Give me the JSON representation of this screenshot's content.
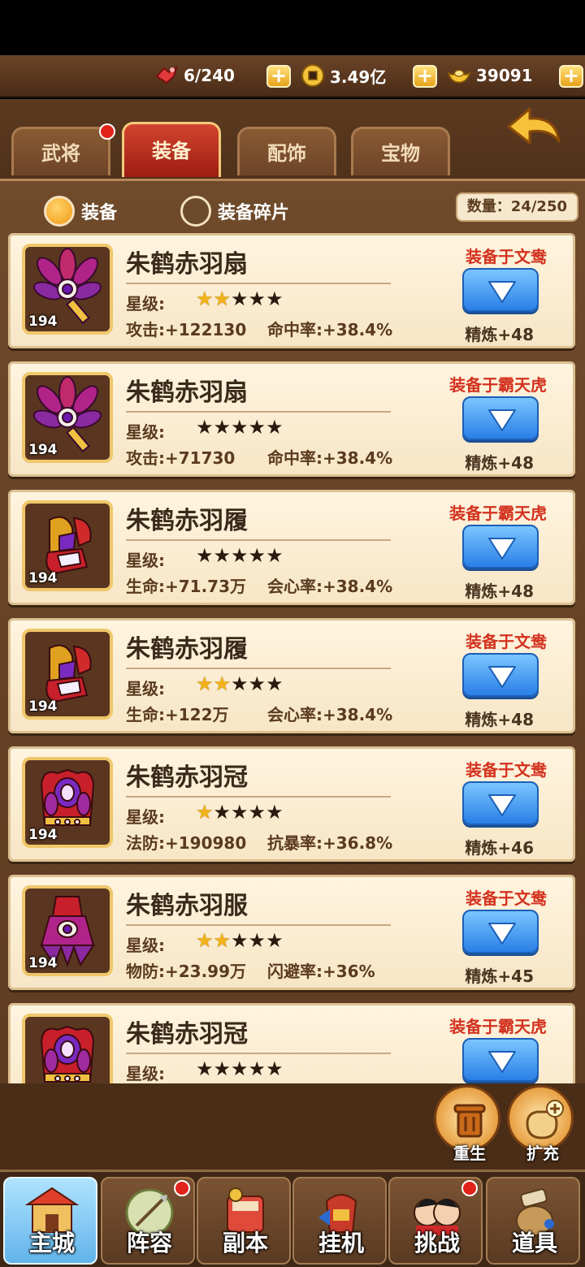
{
  "resources": {
    "stamina": "6/240",
    "coins": "3.49亿",
    "ingots": "39091"
  },
  "tabs": [
    {
      "label": "武将",
      "active": false,
      "has_dot": true
    },
    {
      "label": "装备",
      "active": true,
      "has_dot": false
    },
    {
      "label": "配饰",
      "active": false,
      "has_dot": false
    },
    {
      "label": "宝物",
      "active": false,
      "has_dot": false
    }
  ],
  "filters": {
    "equipment": "装备",
    "fragments": "装备碎片",
    "selected": "装备"
  },
  "count_label": "数量：24/250",
  "star_label": "星级:",
  "items": [
    {
      "name": "朱鹤赤羽扇",
      "level": "194",
      "gold_stars": 2,
      "total_stars": 5,
      "stat1": "攻击:+122130",
      "stat2": "命中率:+38.4%",
      "equipped_by": "装备于文鸯",
      "refine": "精炼+48",
      "icon": "fan-icon"
    },
    {
      "name": "朱鹤赤羽扇",
      "level": "194",
      "gold_stars": 0,
      "total_stars": 5,
      "stat1": "攻击:+71730",
      "stat2": "命中率:+38.4%",
      "equipped_by": "装备于霸天虎",
      "refine": "精炼+48",
      "icon": "fan-icon"
    },
    {
      "name": "朱鹤赤羽履",
      "level": "194",
      "gold_stars": 0,
      "total_stars": 5,
      "stat1": "生命:+71.73万",
      "stat2": "会心率:+38.4%",
      "equipped_by": "装备于霸天虎",
      "refine": "精炼+48",
      "icon": "boots-icon"
    },
    {
      "name": "朱鹤赤羽履",
      "level": "194",
      "gold_stars": 2,
      "total_stars": 5,
      "stat1": "生命:+122万",
      "stat2": "会心率:+38.4%",
      "equipped_by": "装备于文鸯",
      "refine": "精炼+48",
      "icon": "boots-icon"
    },
    {
      "name": "朱鹤赤羽冠",
      "level": "194",
      "gold_stars": 1,
      "total_stars": 5,
      "stat1": "法防:+190980",
      "stat2": "抗暴率:+36.8%",
      "equipped_by": "装备于文鸯",
      "refine": "精炼+46",
      "icon": "crown-icon"
    },
    {
      "name": "朱鹤赤羽服",
      "level": "194",
      "gold_stars": 2,
      "total_stars": 5,
      "stat1": "物防:+23.99万",
      "stat2": "闪避率:+36%",
      "equipped_by": "装备于文鸯",
      "refine": "精炼+45",
      "icon": "robe-icon"
    },
    {
      "name": "朱鹤赤羽冠",
      "level": "194",
      "gold_stars": 0,
      "total_stars": 5,
      "stat1": "",
      "stat2": "",
      "equipped_by": "装备于霸天虎",
      "refine": "",
      "icon": "crown-icon"
    }
  ],
  "actions": {
    "rebirth": "重生",
    "expand": "扩充"
  },
  "nav": [
    {
      "label": "主城",
      "active": true,
      "has_dot": false,
      "icon": "castle-icon"
    },
    {
      "label": "阵容",
      "active": false,
      "has_dot": true,
      "icon": "formation-icon"
    },
    {
      "label": "副本",
      "active": false,
      "has_dot": false,
      "icon": "dungeon-icon"
    },
    {
      "label": "挂机",
      "active": false,
      "has_dot": false,
      "icon": "idle-icon"
    },
    {
      "label": "挑战",
      "active": false,
      "has_dot": true,
      "icon": "challenge-icon"
    },
    {
      "label": "道具",
      "active": false,
      "has_dot": false,
      "icon": "items-icon"
    }
  ],
  "colors": {
    "active_tab": "#c2321f",
    "equip_text": "#d3321f",
    "button_blue": "#2a7fe6",
    "gold_star": "#f2b21a"
  }
}
